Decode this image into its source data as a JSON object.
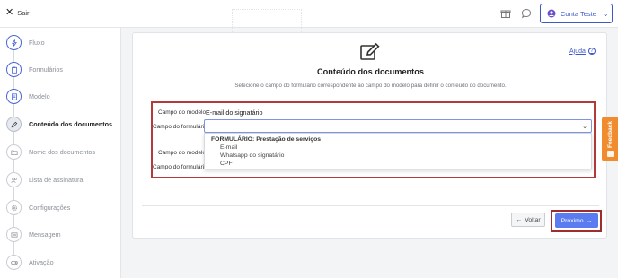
{
  "topbar": {
    "exit_label": "Sair",
    "account_label": "Conta Teste"
  },
  "sidebar": {
    "steps": [
      {
        "label": "Fluxo",
        "icon": "bolt-icon",
        "state": "done"
      },
      {
        "label": "Formulários",
        "icon": "clipboard-icon",
        "state": "done"
      },
      {
        "label": "Modelo",
        "icon": "document-icon",
        "state": "done"
      },
      {
        "label": "Conteúdo dos documentos",
        "icon": "edit-icon",
        "state": "active"
      },
      {
        "label": "Nome dos documentos",
        "icon": "folder-icon",
        "state": "pending"
      },
      {
        "label": "Lista de assinatura",
        "icon": "users-icon",
        "state": "pending"
      },
      {
        "label": "Configurações",
        "icon": "gear-icon",
        "state": "pending"
      },
      {
        "label": "Mensagem",
        "icon": "message-icon",
        "state": "pending"
      },
      {
        "label": "Ativação",
        "icon": "toggle-icon",
        "state": "pending"
      }
    ]
  },
  "content": {
    "help_label": "Ajuda",
    "title": "Conteúdo dos documentos",
    "subtitle": "Selecione o campo do formulário correspondente ao campo do modelo para definir o conteúdo do documento.",
    "mapping": {
      "model_field_label": "Campo do modelo:",
      "model_field_value": "E-mail do signatário",
      "form_field_label": "Campo do formulário:",
      "model_field_label_2": "Campo do modelo:",
      "form_field_label_2": "Campo do formulário:"
    },
    "dropdown": {
      "group": "FORMULÁRIO: Prestação de serviços",
      "options": [
        "E-mail",
        "Whatsapp do signatário",
        "CPF"
      ]
    },
    "buttons": {
      "back": "Voltar",
      "next": "Próximo"
    }
  },
  "feedback_label": "Feedback",
  "colors": {
    "accent": "#3d57c9",
    "primary_button": "#5b7cf0",
    "highlight": "#b23a3a",
    "feedback": "#f08c2e"
  }
}
